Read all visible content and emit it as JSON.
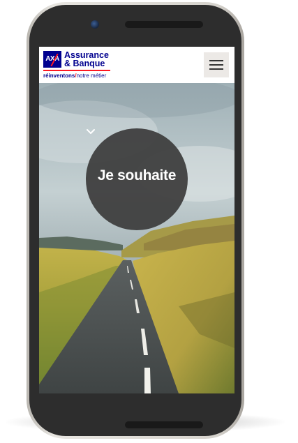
{
  "brand": {
    "logo_mark": "AXA",
    "name_line1": "Assurance",
    "name_line2": "& Banque",
    "tagline_bold": "réinventons",
    "tagline_separator": "/",
    "tagline_rest": "notre métier",
    "colors": {
      "blue": "#00008f",
      "red": "#ff1721"
    }
  },
  "header": {
    "menu_icon": "hamburger-menu-icon"
  },
  "hero": {
    "cta_label": "Je souhaite",
    "cta_icon": "chevron-down-icon",
    "circle_color": "#3e3e3e"
  }
}
